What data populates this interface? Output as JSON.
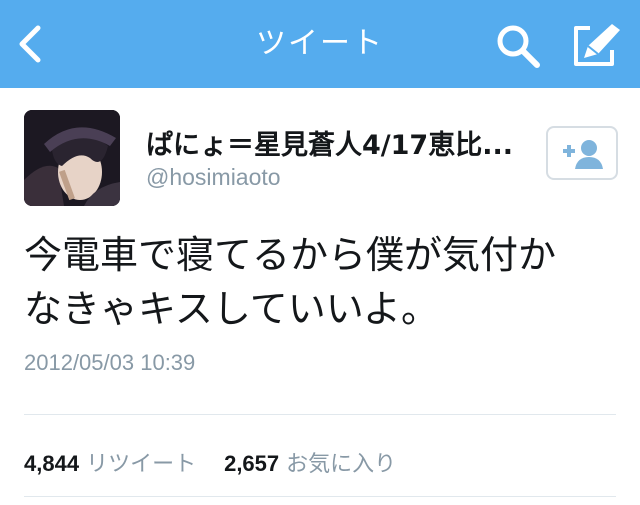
{
  "nav": {
    "title": "ツイート",
    "back_icon": "chevron-left-icon",
    "search_icon": "search-icon",
    "compose_icon": "compose-tweet-icon",
    "bar_color": "#55acee"
  },
  "tweet": {
    "display_name": "ぱにょ＝星見蒼人4/17恵比...",
    "screen_name": "@hosimiaoto",
    "text_line1": "今電車で寝てるから僕が気付か",
    "text_line2": "なきゃキスしていいよ。",
    "timestamp": "2012/05/03 10:39"
  },
  "follow_button": {
    "icon": "add-user-icon"
  },
  "stats": {
    "retweets_count": "4,844",
    "retweets_label": "リツイート",
    "favorites_count": "2,657",
    "favorites_label": "お気に入り"
  },
  "colors": {
    "text": "#14171a",
    "muted": "#8899a6",
    "divider": "#e1e8ed",
    "follow_icon": "#7fb4dc"
  }
}
